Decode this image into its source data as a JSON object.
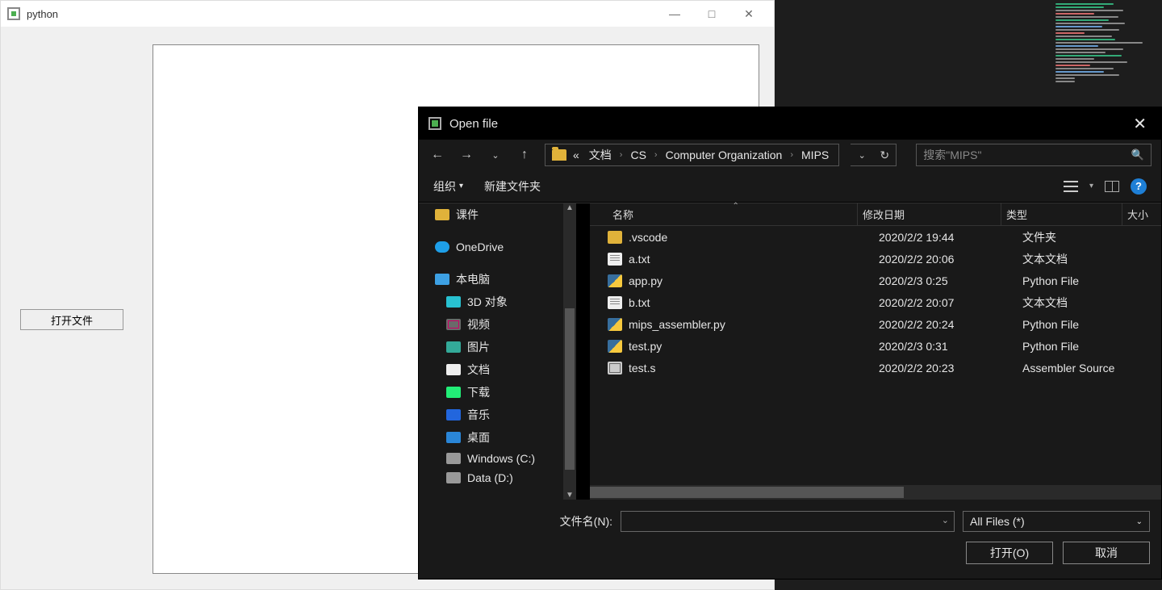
{
  "pywin": {
    "title": "python",
    "open_button": "打开文件"
  },
  "dialog": {
    "title": "Open file",
    "breadcrumb": {
      "prefix": "«",
      "parts": [
        "文档",
        "CS",
        "Computer Organization",
        "MIPS"
      ]
    },
    "search_placeholder": "搜索\"MIPS\"",
    "toolbar": {
      "organize": "组织",
      "new_folder": "新建文件夹"
    },
    "columns": {
      "name": "名称",
      "date": "修改日期",
      "type": "类型",
      "size": "大小"
    },
    "sidebar": [
      {
        "label": "课件",
        "icon": "folder",
        "indent": "top"
      },
      {
        "label": "OneDrive",
        "icon": "onedrive",
        "indent": "top"
      },
      {
        "label": "本电脑",
        "icon": "pc",
        "indent": "top"
      },
      {
        "label": "3D 对象",
        "icon": "cube"
      },
      {
        "label": "视频",
        "icon": "video"
      },
      {
        "label": "图片",
        "icon": "pic"
      },
      {
        "label": "文档",
        "icon": "doc"
      },
      {
        "label": "下载",
        "icon": "down"
      },
      {
        "label": "音乐",
        "icon": "music"
      },
      {
        "label": "桌面",
        "icon": "desk"
      },
      {
        "label": "Windows (C:)",
        "icon": "drive"
      },
      {
        "label": "Data (D:)",
        "icon": "drive"
      }
    ],
    "files": [
      {
        "name": ".vscode",
        "date": "2020/2/2 19:44",
        "type": "文件夹",
        "icon": "folder"
      },
      {
        "name": "a.txt",
        "date": "2020/2/2 20:06",
        "type": "文本文档",
        "icon": "txt"
      },
      {
        "name": "app.py",
        "date": "2020/2/3 0:25",
        "type": "Python File",
        "icon": "py"
      },
      {
        "name": "b.txt",
        "date": "2020/2/2 20:07",
        "type": "文本文档",
        "icon": "txt"
      },
      {
        "name": "mips_assembler.py",
        "date": "2020/2/2 20:24",
        "type": "Python File",
        "icon": "py"
      },
      {
        "name": "test.py",
        "date": "2020/2/3 0:31",
        "type": "Python File",
        "icon": "py"
      },
      {
        "name": "test.s",
        "date": "2020/2/2 20:23",
        "type": "Assembler Source",
        "icon": "asm"
      }
    ],
    "footer": {
      "filename_label": "文件名(N):",
      "filter": "All Files  (*)",
      "open": "打开(O)",
      "cancel": "取消"
    }
  }
}
